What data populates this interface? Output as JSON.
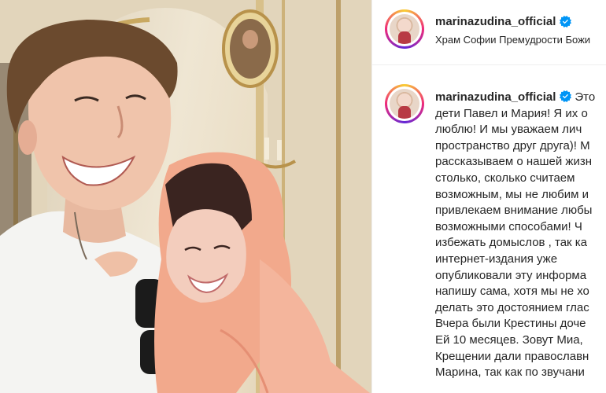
{
  "post": {
    "username": "marinazudina_official",
    "verified": true,
    "location": "Храм Софии Премудрости Божи",
    "caption": "Это\nдети Павел и Мария! Я их о\nлюблю! И мы уважаем лич\nпространство друг друга)! М\nрассказываем о нашей жизн\nстолько, сколько считаем\nвозможным, мы не любим и\nпривлекаем внимание любы\nвозможными способами! Ч\nизбежать домыслов , так ка\nинтернет-издания уже\nопубликовали эту информа\nнапишу сама, хотя мы не хо\nделать это достоянием глас\nВчера были Крестины доче\nЕй 10 месяцев. Зовут Миа,\nКрещении дали православн\nМарина, так как по звучани"
  },
  "icons": {
    "verified": "verified-badge-icon",
    "avatar": "profile-avatar"
  },
  "colors": {
    "verified": "#0095f6",
    "text": "#262626",
    "divider": "#efefef"
  }
}
